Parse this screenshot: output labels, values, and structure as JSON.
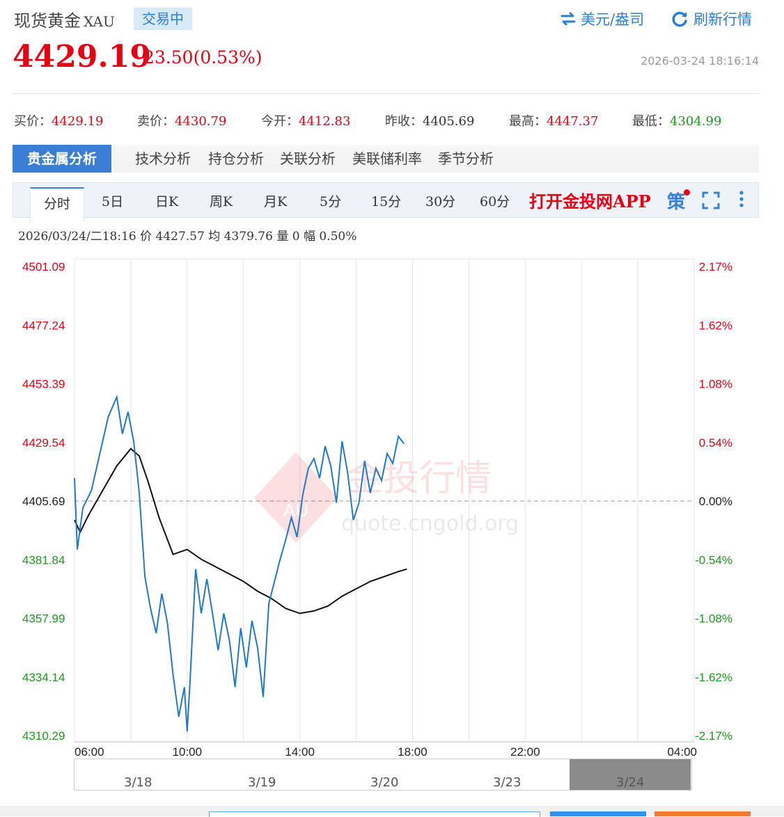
{
  "header": {
    "name": "现货黄金",
    "symbol": "XAU",
    "status": "交易中",
    "currency_toggle": "美元/盎司",
    "refresh": "刷新行情"
  },
  "quote": {
    "price": "4429.19",
    "change": "23.50(0.53%)",
    "timestamp": "2026-03-24 18:16:14",
    "fields": [
      {
        "label": "买价：",
        "value": "4429.19",
        "color": "#e60012"
      },
      {
        "label": "卖价：",
        "value": "4430.79",
        "color": "#e60012"
      },
      {
        "label": "今开：",
        "value": "4412.83",
        "color": "#e60012"
      },
      {
        "label": "昨收：",
        "value": "4405.69",
        "color": "#333333"
      },
      {
        "label": "最高：",
        "value": "4447.37",
        "color": "#e60012"
      },
      {
        "label": "最低：",
        "value": "4304.99",
        "color": "#1a9a1a"
      }
    ]
  },
  "analysis_tabs": [
    "贵金属分析",
    "技术分析",
    "持仓分析",
    "关联分析",
    "美联储利率",
    "季节分析"
  ],
  "period_tabs": [
    "分时",
    "5日",
    "日K",
    "周K",
    "月K",
    "5分",
    "15分",
    "30分",
    "60分"
  ],
  "app_link": "打开金投网APP",
  "strategy_label": "策",
  "info_line": "2026/03/24/二18:16  价 4427.57  均 4379.76  量 0  幅 0.50%",
  "watermark": {
    "brand": "金投行情",
    "url": "quote.cngold.org",
    "logo": "AU"
  },
  "chart_data": {
    "type": "line",
    "y_left_ticks": [
      "4501.09",
      "4477.24",
      "4453.39",
      "4429.54",
      "4405.69",
      "4381.84",
      "4357.99",
      "4334.14",
      "4310.29"
    ],
    "y_right_ticks": [
      "2.17%",
      "1.62%",
      "1.08%",
      "0.54%",
      "0.00%",
      "-0.54%",
      "-1.08%",
      "-1.62%",
      "-2.17%"
    ],
    "x_ticks": [
      "06:00",
      "10:00",
      "14:00",
      "18:00",
      "22:00",
      "04:00"
    ],
    "ylim": [
      4310.29,
      4501.09
    ],
    "reference": 4405.69,
    "colors": {
      "price": "#1f78c8",
      "avg": "#111111",
      "up": "#e60012",
      "down": "#1a9a1a"
    },
    "price_series": {
      "name": "价",
      "hours": [
        6.0,
        6.1,
        6.3,
        6.6,
        6.9,
        7.2,
        7.5,
        7.7,
        7.9,
        8.1,
        8.3,
        8.5,
        8.7,
        8.9,
        9.1,
        9.3,
        9.5,
        9.7,
        9.9,
        10.0,
        10.1,
        10.3,
        10.5,
        10.7,
        10.9,
        11.1,
        11.3,
        11.5,
        11.7,
        11.9,
        12.1,
        12.3,
        12.5,
        12.7,
        12.9,
        13.1,
        13.3,
        13.5,
        13.7,
        13.9,
        14.1,
        14.3,
        14.5,
        14.7,
        14.9,
        15.1,
        15.3,
        15.5,
        15.7,
        15.9,
        16.1,
        16.3,
        16.5,
        16.7,
        16.9,
        17.1,
        17.3,
        17.5,
        17.7
      ],
      "values": [
        4415,
        4386,
        4403,
        4410,
        4425,
        4440,
        4448,
        4433,
        4442,
        4430,
        4409,
        4375,
        4362,
        4352,
        4368,
        4356,
        4335,
        4318,
        4330,
        4312,
        4332,
        4378,
        4360,
        4374,
        4360,
        4345,
        4360,
        4349,
        4330,
        4354,
        4338,
        4357,
        4346,
        4326,
        4364,
        4373,
        4382,
        4390,
        4399,
        4391,
        4408,
        4419,
        4423,
        4415,
        4428,
        4420,
        4405,
        4430,
        4417,
        4398,
        4405,
        4422,
        4409,
        4419,
        4414,
        4425,
        4421,
        4432,
        4429
      ]
    },
    "avg_series": {
      "name": "均",
      "hours": [
        6.0,
        6.2,
        6.5,
        7.0,
        7.5,
        8.0,
        8.3,
        8.6,
        9.0,
        9.5,
        10.0,
        10.5,
        11.0,
        11.5,
        12.0,
        12.5,
        13.0,
        13.5,
        14.0,
        14.5,
        15.0,
        15.5,
        16.0,
        16.5,
        17.0,
        17.5,
        17.8
      ],
      "values": [
        4398,
        4393,
        4400,
        4410,
        4420,
        4427,
        4424,
        4414,
        4399,
        4384,
        4386,
        4382,
        4379,
        4376,
        4373,
        4369,
        4366,
        4362,
        4360,
        4361,
        4363,
        4367,
        4370,
        4373,
        4375,
        4377,
        4378
      ]
    },
    "navigator_labels": [
      "3/18",
      "3/19",
      "3/20",
      "3/23",
      "3/24"
    ]
  }
}
